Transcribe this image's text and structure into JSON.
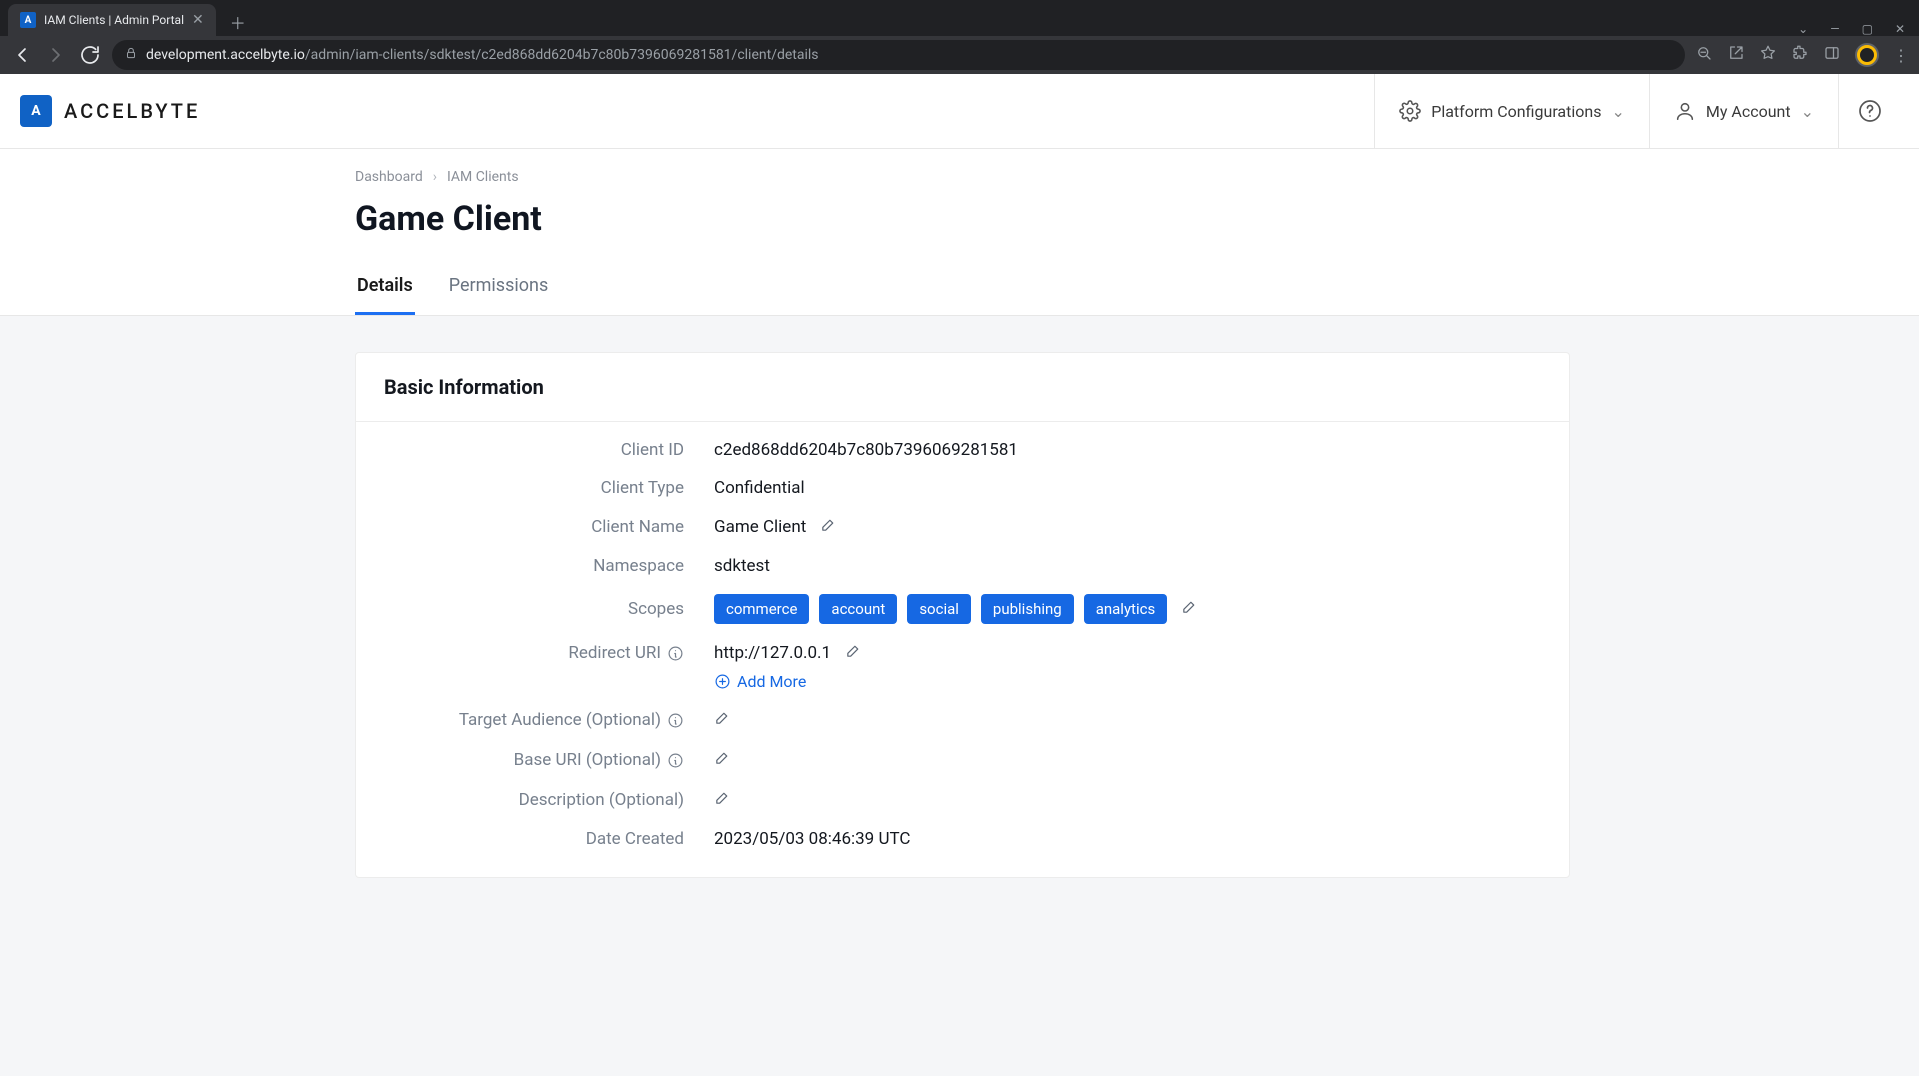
{
  "browser": {
    "tab_title": "IAM Clients | Admin Portal",
    "url_host": "development.accelbyte.io",
    "url_path": "/admin/iam-clients/sdktest/c2ed868dd6204b7c80b7396069281581/client/details"
  },
  "header": {
    "brand": "ACCELBYTE",
    "platform_config": "Platform Configurations",
    "my_account": "My Account"
  },
  "breadcrumb": {
    "dashboard": "Dashboard",
    "iam_clients": "IAM Clients"
  },
  "page_title": "Game Client",
  "tabs": {
    "details": "Details",
    "permissions": "Permissions"
  },
  "card": {
    "title": "Basic Information",
    "labels": {
      "client_id": "Client ID",
      "client_type": "Client Type",
      "client_name": "Client Name",
      "namespace": "Namespace",
      "scopes": "Scopes",
      "redirect_uri": "Redirect URI",
      "target_audience": "Target Audience (Optional)",
      "base_uri": "Base URI (Optional)",
      "description": "Description (Optional)",
      "date_created": "Date Created"
    },
    "values": {
      "client_id": "c2ed868dd6204b7c80b7396069281581",
      "client_type": "Confidential",
      "client_name": "Game Client",
      "namespace": "sdktest",
      "redirect_uri": "http://127.0.0.1",
      "date_created": "2023/05/03 08:46:39 UTC"
    },
    "scopes": [
      "commerce",
      "account",
      "social",
      "publishing",
      "analytics"
    ],
    "add_more": "Add More"
  }
}
